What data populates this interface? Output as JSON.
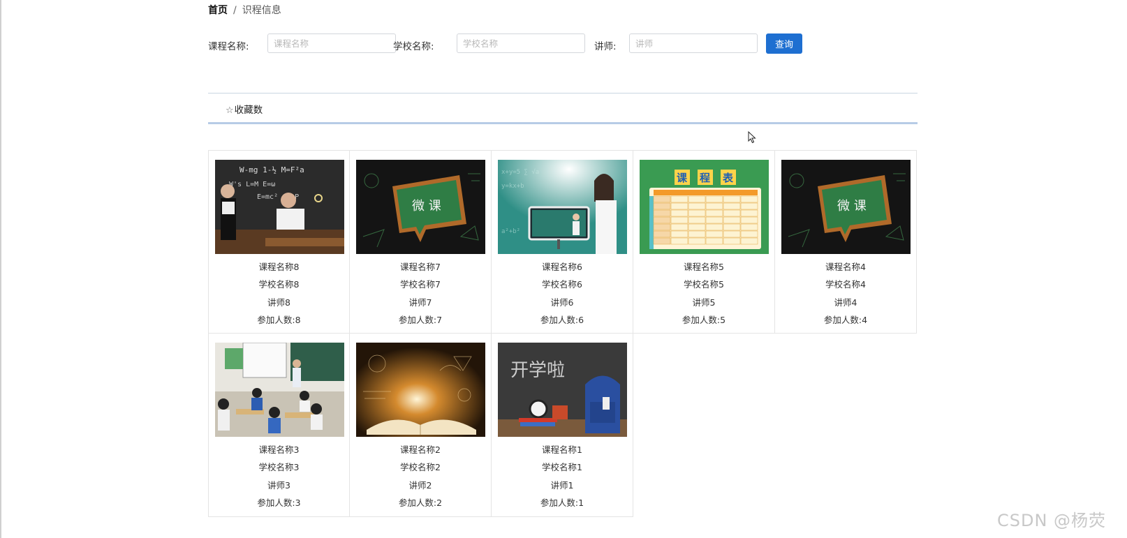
{
  "breadcrumb": {
    "home": "首页",
    "separator": "/",
    "current": "识程信息"
  },
  "search": {
    "course_label": "课程名称:",
    "course_placeholder": "课程名称",
    "school_label": "学校名称:",
    "school_placeholder": "学校名称",
    "teacher_label": "讲师:",
    "teacher_placeholder": "讲师",
    "query_button": "查询"
  },
  "sort": {
    "favorites_label": "收藏数",
    "favorites_icon": "star-outline-icon"
  },
  "courses": [
    {
      "name": "课程名称8",
      "school": "学校名称8",
      "teacher": "讲师8",
      "participants": "参加人数:8",
      "image": "classroom-blackboard-kids"
    },
    {
      "name": "课程名称7",
      "school": "学校名称7",
      "teacher": "讲师7",
      "participants": "参加人数:7",
      "image": "micro-class-chalkboard",
      "image_text": "微 课"
    },
    {
      "name": "课程名称6",
      "school": "学校名称6",
      "teacher": "讲师6",
      "participants": "参加人数:6",
      "image": "teacher-online-class"
    },
    {
      "name": "课程名称5",
      "school": "学校名称5",
      "teacher": "讲师5",
      "participants": "参加人数:5",
      "image": "timetable",
      "image_text": "课 程 表"
    },
    {
      "name": "课程名称4",
      "school": "学校名称4",
      "teacher": "讲师4",
      "participants": "参加人数:4",
      "image": "micro-class-chalkboard",
      "image_text": "微 课"
    },
    {
      "name": "课程名称3",
      "school": "学校名称3",
      "teacher": "讲师3",
      "participants": "参加人数:3",
      "image": "classroom-students"
    },
    {
      "name": "课程名称2",
      "school": "学校名称2",
      "teacher": "讲师2",
      "participants": "参加人数:2",
      "image": "glowing-book"
    },
    {
      "name": "课程名称1",
      "school": "学校名称1",
      "teacher": "讲师1",
      "participants": "参加人数:1",
      "image": "back-to-school",
      "image_text": "开学啦"
    }
  ],
  "watermark": "CSDN @杨荧",
  "colors": {
    "primary_button": "#1e6fd1",
    "sort_underline": "#b7cce6",
    "card_border": "#e4e4e4"
  }
}
